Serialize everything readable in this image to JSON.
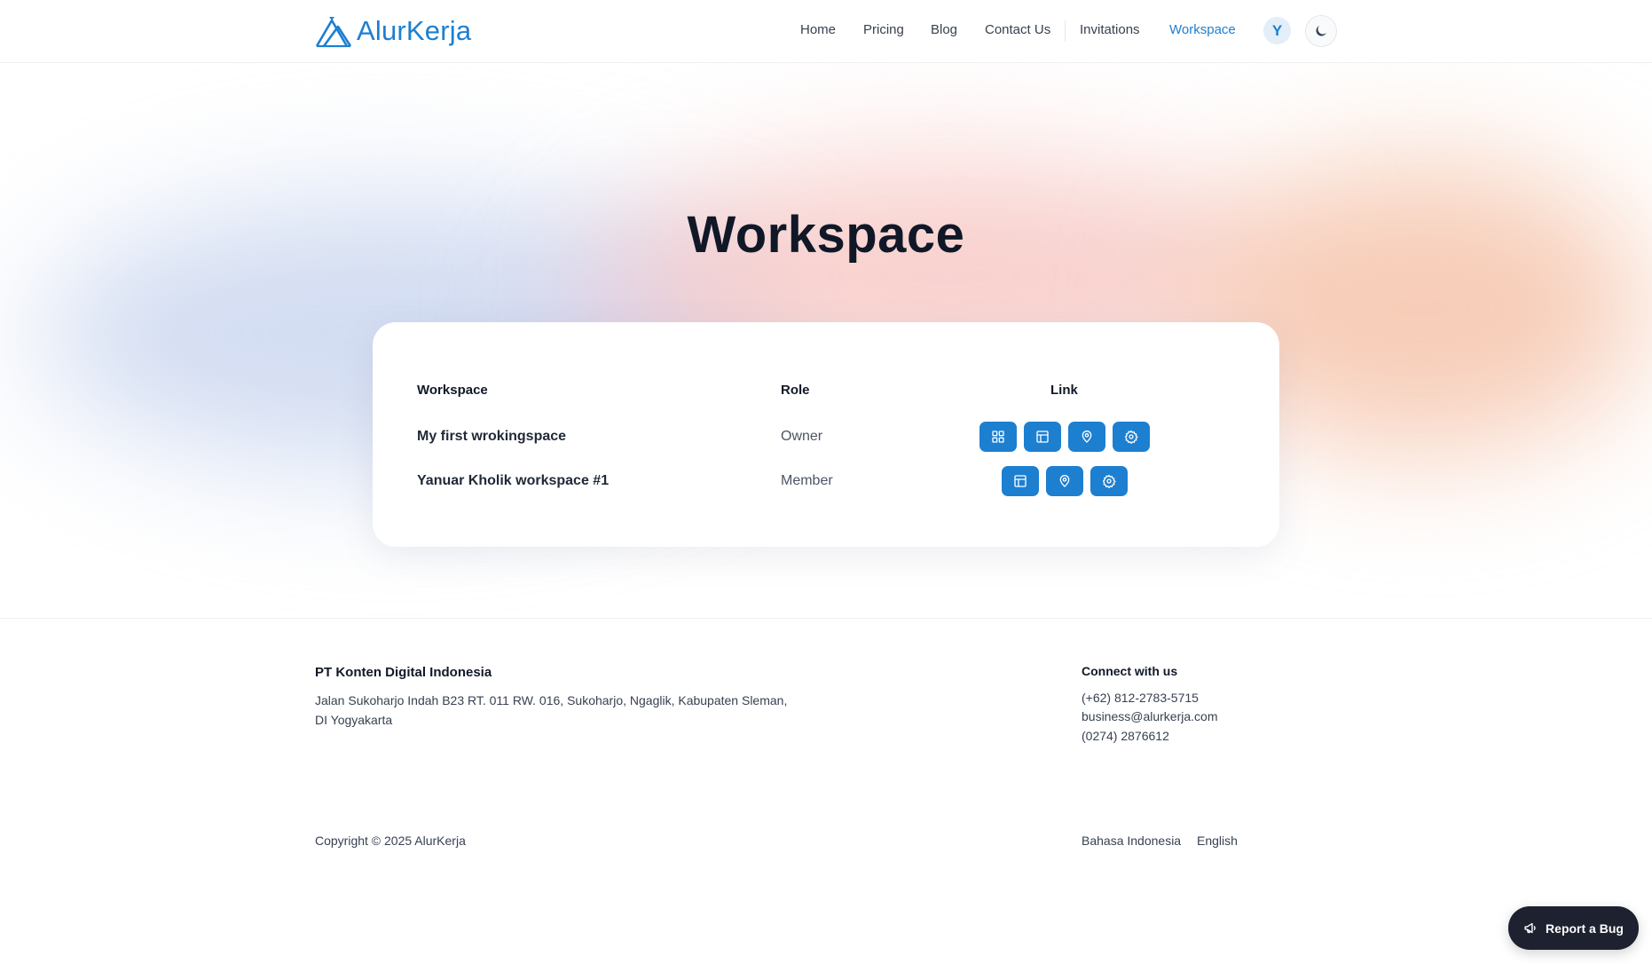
{
  "brand": {
    "name": "AlurKerja",
    "color": "#1d7fd0"
  },
  "nav": {
    "home": "Home",
    "pricing": "Pricing",
    "blog": "Blog",
    "contact": "Contact Us",
    "invitations": "Invitations",
    "workspace": "Workspace",
    "active": "Workspace",
    "avatar_initial": "Y",
    "theme_icon": "moon-icon"
  },
  "main": {
    "title": "Workspace",
    "table": {
      "headers": {
        "workspace": "Workspace",
        "role": "Role",
        "link": "Link"
      },
      "rows": [
        {
          "workspace": "My first wrokingspace",
          "role": "Owner",
          "links": [
            "grid-icon",
            "layout-icon",
            "map-pin-icon",
            "settings-icon"
          ]
        },
        {
          "workspace": "Yanuar Kholik workspace #1",
          "role": "Member",
          "links": [
            "layout-icon",
            "map-pin-icon",
            "settings-icon"
          ]
        }
      ]
    }
  },
  "footer": {
    "company": "PT Konten Digital Indonesia",
    "address": "Jalan Sukoharjo Indah B23 RT. 011 RW. 016, Sukoharjo, Ngaglik, Kabupaten Sleman, DI Yogyakarta",
    "connect_title": "Connect with us",
    "phone": "(+62) 812-2783-5715",
    "email": "business@alurkerja.com",
    "phone2": "(0274) 2876612",
    "copyright": "Copyright © 2025 AlurKerja",
    "lang_id": "Bahasa Indonesia",
    "lang_en": "English"
  },
  "report_bug": {
    "label": "Report a Bug",
    "icon": "megaphone-icon"
  }
}
